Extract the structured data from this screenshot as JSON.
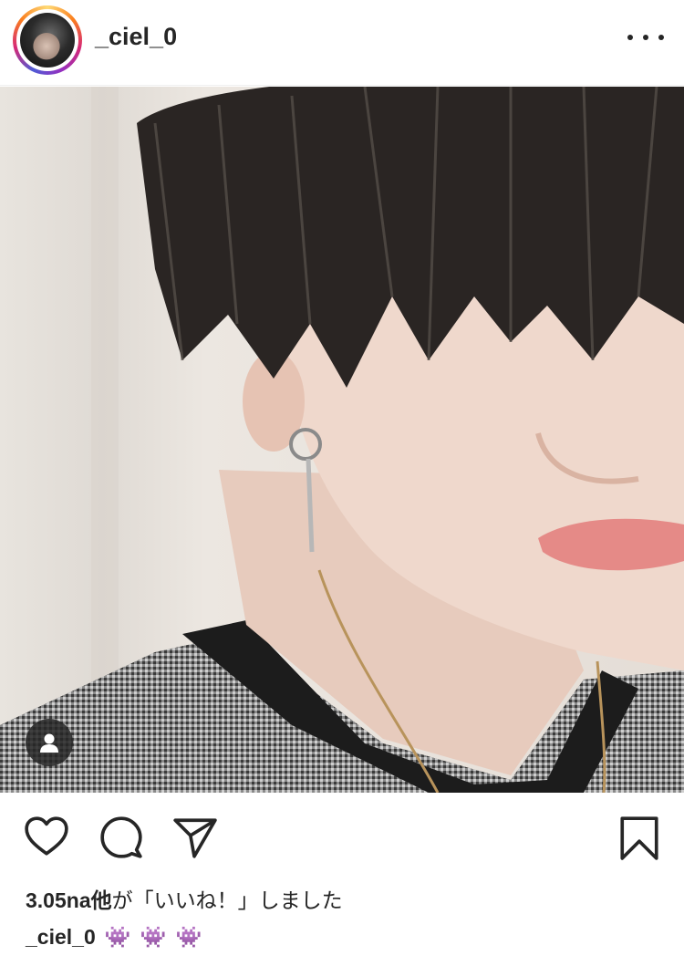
{
  "post": {
    "username": "_ciel_0",
    "likes_count": "3.05na他",
    "likes_suffix": "が「いいね！」しました",
    "caption_user": "_ciel_0",
    "caption_text": "👾 👾 👾"
  },
  "icons": {
    "more": "more-options-icon",
    "like": "heart-icon",
    "comment": "comment-icon",
    "share": "send-icon",
    "save": "bookmark-icon",
    "tag": "user-tag-icon"
  },
  "colors": {
    "text": "#262626",
    "story_ring_start": "#feda75",
    "story_ring_end": "#d62976"
  }
}
